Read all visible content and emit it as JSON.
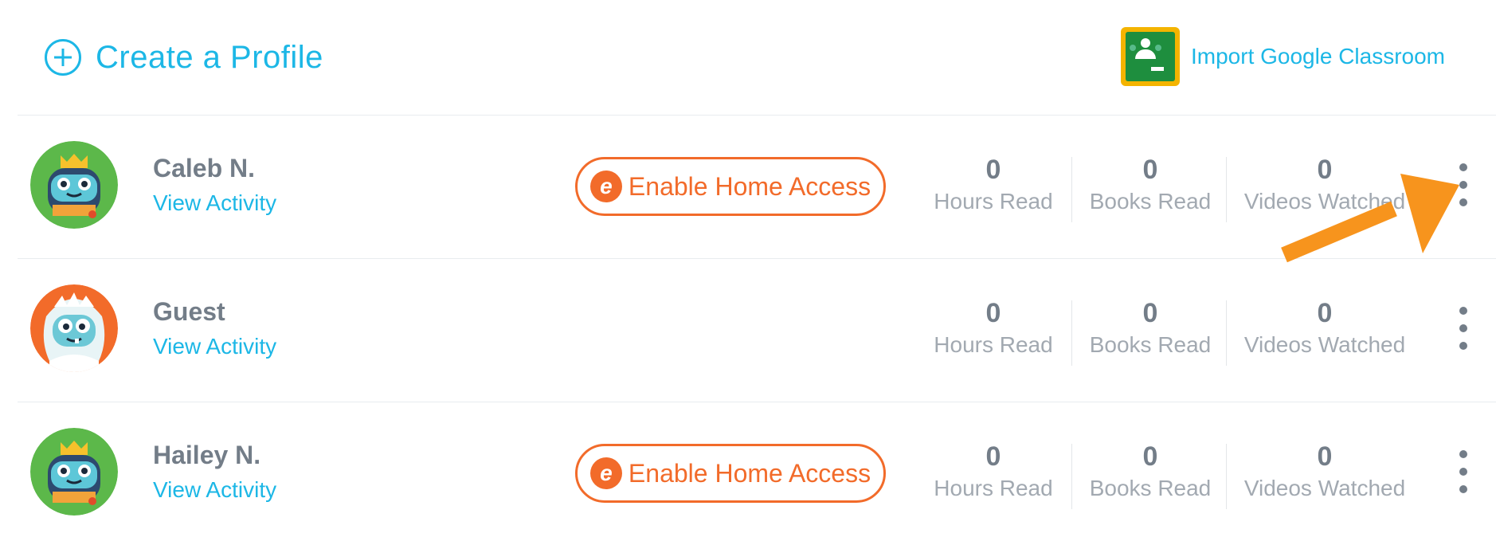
{
  "header": {
    "create_label": "Create a Profile",
    "import_label": "Import Google Classroom"
  },
  "profiles": [
    {
      "name": "Caleb N.",
      "view_activity": "View Activity",
      "home_access_label": "Enable Home Access",
      "avatar": "robot-green",
      "stats": [
        {
          "value": "0",
          "label": "Hours Read"
        },
        {
          "value": "0",
          "label": "Books Read"
        },
        {
          "value": "0",
          "label": "Videos Watched"
        }
      ]
    },
    {
      "name": "Guest",
      "view_activity": "View Activity",
      "avatar": "yeti-orange",
      "stats": [
        {
          "value": "0",
          "label": "Hours Read"
        },
        {
          "value": "0",
          "label": "Books Read"
        },
        {
          "value": "0",
          "label": "Videos Watched"
        }
      ]
    },
    {
      "name": "Hailey N.",
      "view_activity": "View Activity",
      "home_access_label": "Enable Home Access",
      "avatar": "robot-green",
      "stats": [
        {
          "value": "0",
          "label": "Hours Read"
        },
        {
          "value": "0",
          "label": "Books Read"
        },
        {
          "value": "0",
          "label": "Videos Watched"
        }
      ]
    }
  ],
  "icons": {
    "create": "plus-circle-icon",
    "import": "google-classroom-icon",
    "home_access": "epic-logo-icon",
    "more": "more-vertical-icon"
  },
  "colors": {
    "accent_blue": "#1cb7e6",
    "accent_orange": "#f26b2a",
    "text_gray": "#737d88",
    "label_gray": "#a2a9b1",
    "annotation_arrow": "#f7941d"
  }
}
